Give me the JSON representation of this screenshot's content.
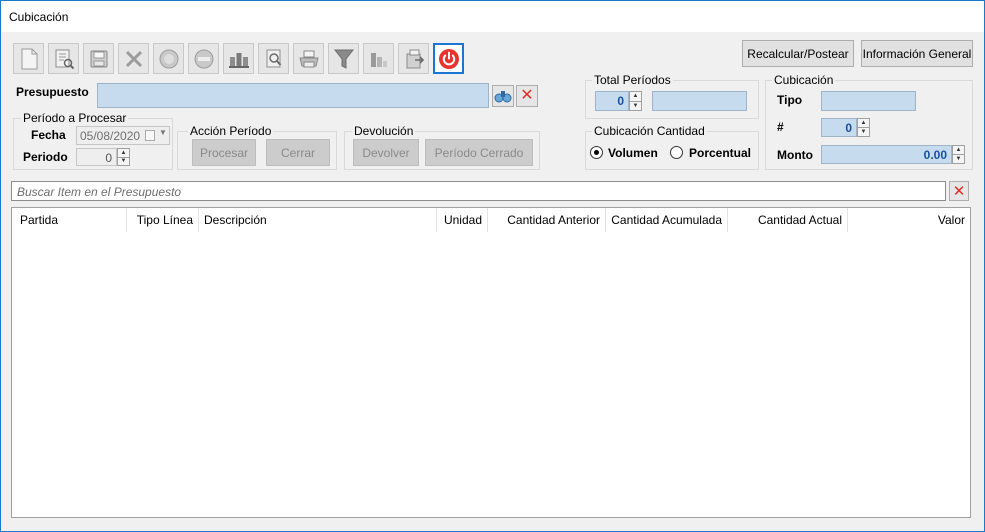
{
  "window": {
    "title": "Cubicación"
  },
  "toolbar": {
    "buttons": [
      "new-document-icon",
      "edit-document-icon",
      "save-icon",
      "delete-icon",
      "approve-icon",
      "reject-icon",
      "structure-icon",
      "preview-icon",
      "print-icon",
      "filter-icon",
      "chart-icon",
      "export-icon",
      "power-icon"
    ]
  },
  "actions": {
    "recalc": "Recalcular/Postear",
    "info": "Información General"
  },
  "presupuesto": {
    "label": "Presupuesto",
    "value": ""
  },
  "periodo_procesar": {
    "title": "Período a Procesar",
    "fecha_label": "Fecha",
    "fecha_value": "05/08/2020",
    "periodo_label": "Periodo",
    "periodo_value": "0"
  },
  "accion_periodo": {
    "title": "Acción Período",
    "procesar": "Procesar",
    "cerrar": "Cerrar"
  },
  "devolucion": {
    "title": "Devolución",
    "devolver": "Devolver",
    "periodo_cerrado": "Período Cerrado"
  },
  "total_periodos": {
    "title": "Total Períodos",
    "value": "0",
    "extra": ""
  },
  "cubicacion_cantidad": {
    "title": "Cubicación Cantidad",
    "volumen": "Volumen",
    "porcentual": "Porcentual",
    "selected": "Volumen"
  },
  "cubicacion": {
    "title": "Cubicación",
    "tipo_label": "Tipo",
    "tipo_value": "",
    "num_label": "#",
    "num_value": "0",
    "monto_label": "Monto",
    "monto_value": "0.00"
  },
  "search": {
    "placeholder": "Buscar Item en el Presupuesto"
  },
  "grid": {
    "columns": [
      "Partida",
      "Tipo Línea",
      "Descripción",
      "Unidad",
      "Cantidad Anterior",
      "Cantidad Acumulada",
      "Cantidad Actual",
      "Valor"
    ],
    "rows": []
  },
  "colors": {
    "accent": "#1a76d2",
    "input_fill": "#c7dbef",
    "clear_red": "#d9322c"
  }
}
